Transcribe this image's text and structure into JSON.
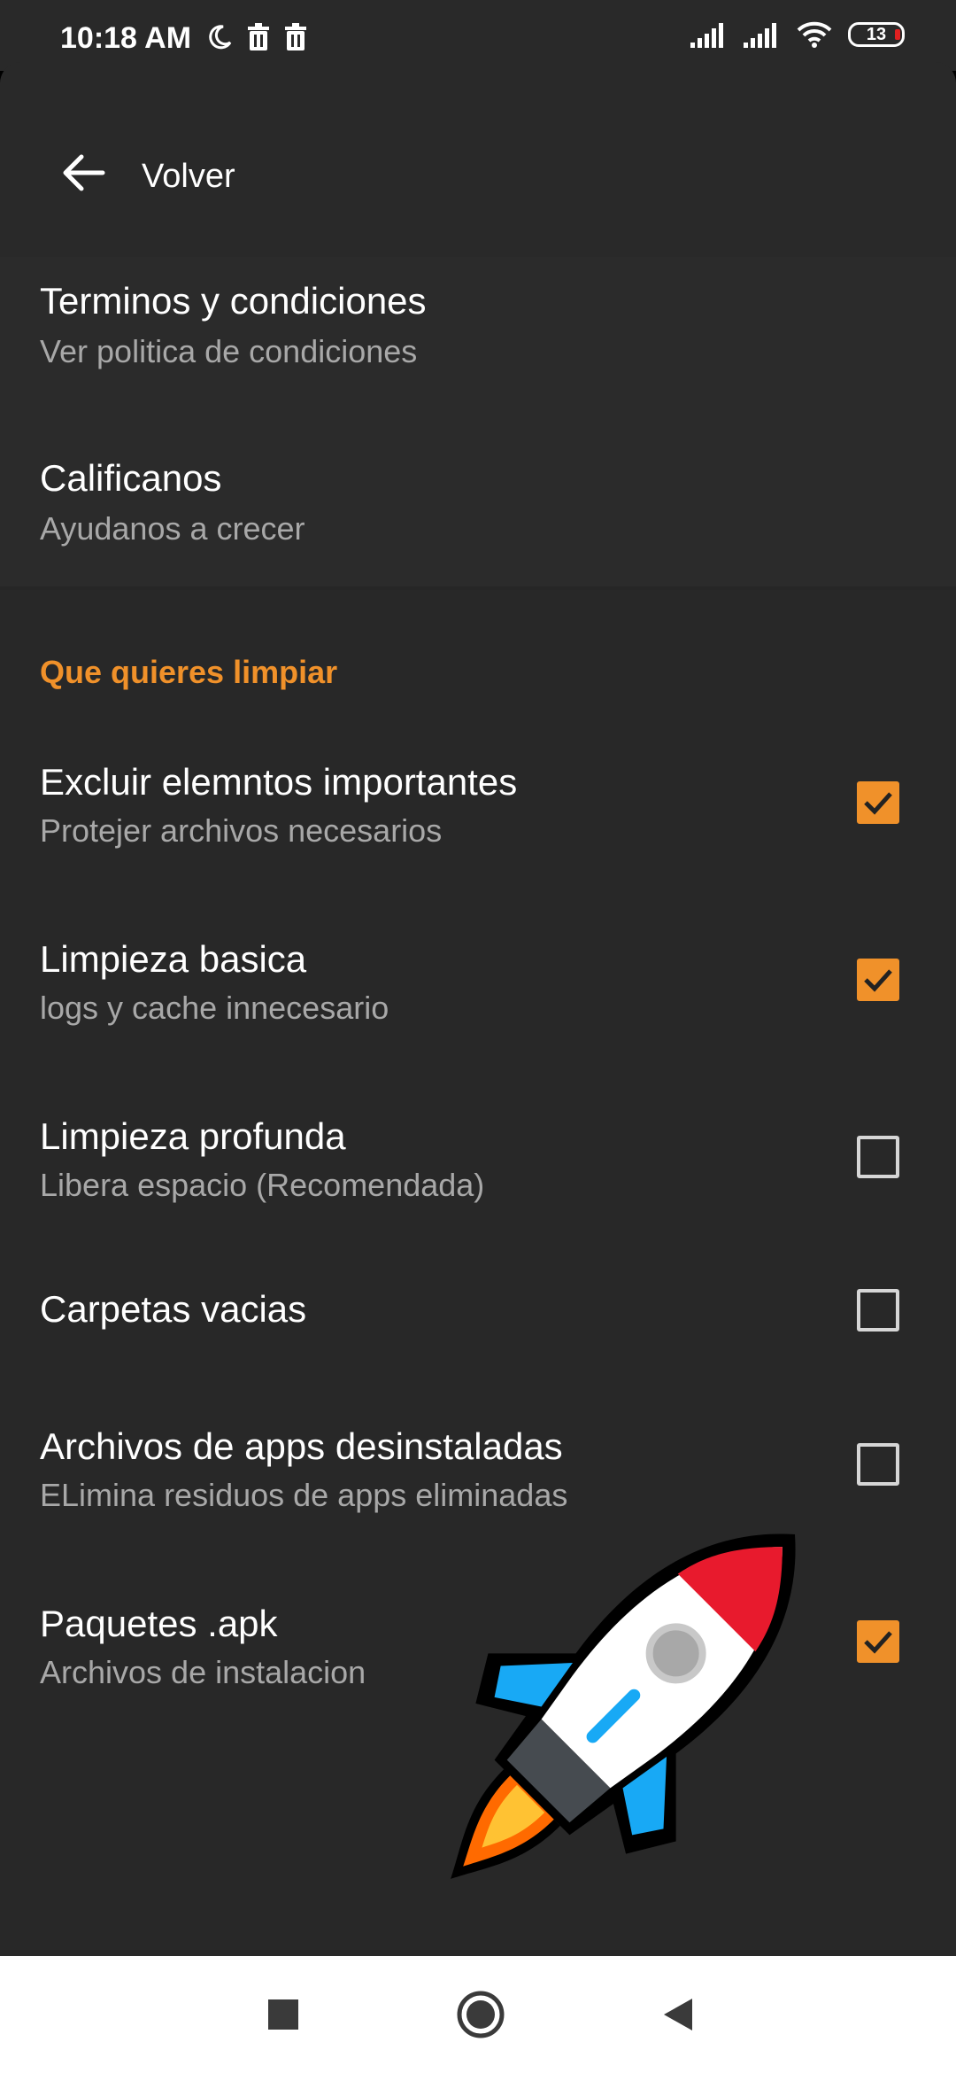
{
  "status_bar": {
    "time": "10:18 AM",
    "battery": "13",
    "left_icons": [
      "moon-icon",
      "trash-icon",
      "trash-icon"
    ],
    "right_icons": [
      "signal-icon",
      "signal-icon",
      "wifi-icon",
      "battery-icon"
    ]
  },
  "header": {
    "back_label": "Volver",
    "back_icon": "arrow-left-icon"
  },
  "top_items": [
    {
      "title": "Terminos y condiciones",
      "subtitle": "Ver politica de condiciones"
    },
    {
      "title": "Calificanos",
      "subtitle": "Ayudanos a crecer"
    }
  ],
  "section": {
    "title": "Que quieres limpiar",
    "items": [
      {
        "title": "Excluir elemntos importantes",
        "subtitle": "Protejer archivos necesarios",
        "checked": true
      },
      {
        "title": "Limpieza basica",
        "subtitle": "logs y cache innecesario",
        "checked": true
      },
      {
        "title": "Limpieza profunda",
        "subtitle": "Libera espacio (Recomendada)",
        "checked": false
      },
      {
        "title": "Carpetas vacias",
        "subtitle": "",
        "checked": false
      },
      {
        "title": "Archivos de apps desinstaladas",
        "subtitle": "ELimina residuos de apps eliminadas",
        "checked": false
      },
      {
        "title": "Paquetes .apk",
        "subtitle": "Archivos de instalacion",
        "checked": true
      }
    ]
  },
  "nav_bar": {
    "buttons": [
      "square-icon",
      "home-circle-icon",
      "back-triangle-icon"
    ]
  },
  "colors": {
    "accent": "#f0912a",
    "background": "#292929",
    "text_secondary": "#a8a8a8"
  },
  "decoration": {
    "icon": "rocket-icon"
  }
}
